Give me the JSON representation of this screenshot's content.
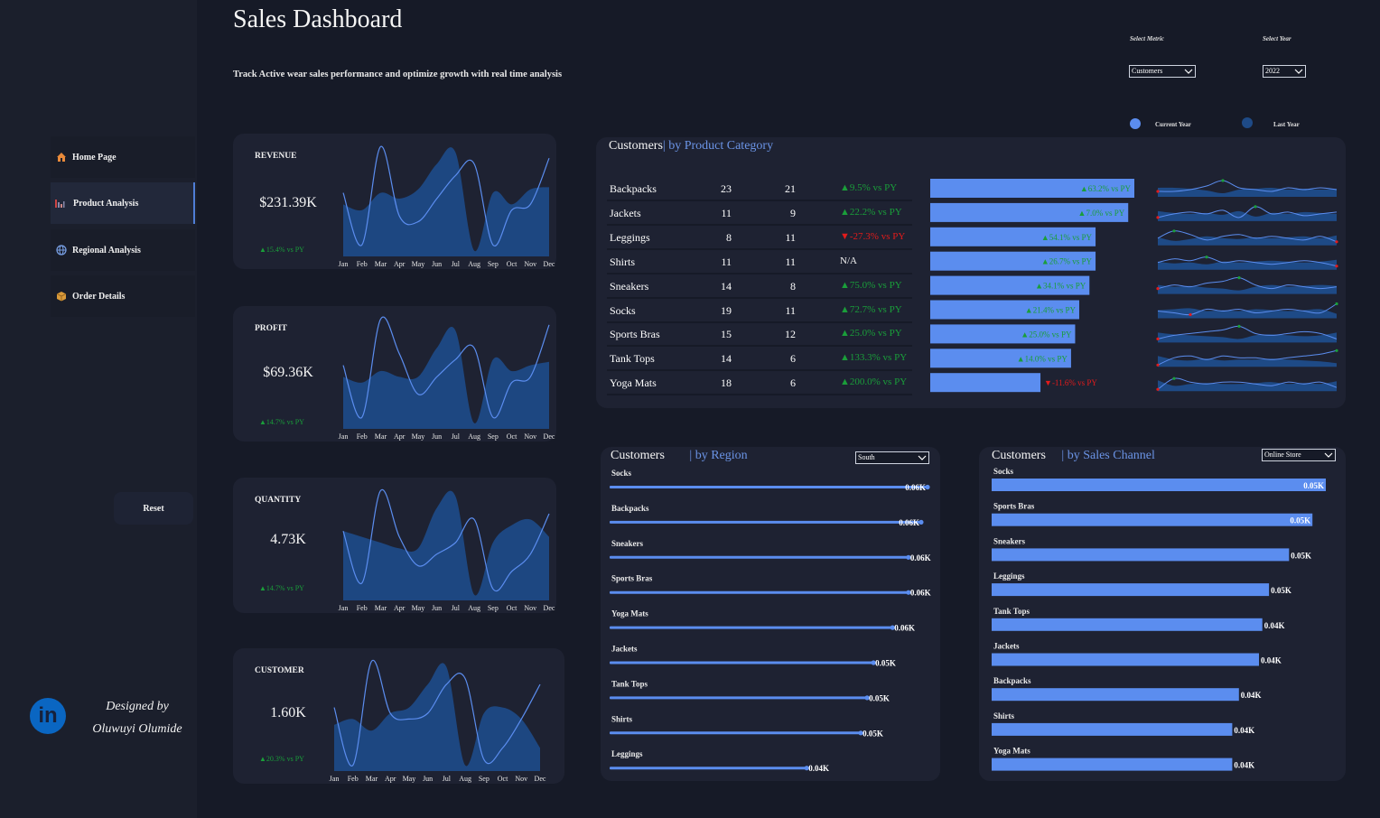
{
  "header": {
    "title": "Sales Dashboard",
    "subtitle": "Track Active wear sales performance and optimize growth with real time analysis",
    "metric_label": "Select Metric",
    "metric_value": "Customers",
    "year_label": "Select Year",
    "year_value": "2022",
    "legend_current": "Current Year",
    "legend_last": "Last Year"
  },
  "colors": {
    "accent": "#6b94e6",
    "current": "#5b8def",
    "last": "#1e4a86",
    "up": "#1a9e3a",
    "down": "#e21b1b",
    "bg": "#161a27",
    "card": "#1e2232"
  },
  "nav": {
    "home": "Home Page",
    "product": "Product Analysis",
    "regional": "Regional Analysis",
    "orders": "Order Details",
    "icons": {
      "home": "home-icon",
      "product": "bar-chart-icon",
      "regional": "globe-icon",
      "orders": "box-icon"
    }
  },
  "reset_label": "Reset",
  "designer": {
    "line1": "Designed by",
    "line2": "Oluwuyi Olumide",
    "icon": "in"
  },
  "months": [
    "Jan",
    "Feb",
    "Mar",
    "Apr",
    "May",
    "Jun",
    "Jul",
    "Aug",
    "Sep",
    "Oct",
    "Nov",
    "Dec"
  ],
  "kpis": [
    {
      "label": "REVENUE",
      "value": "$231.39K",
      "delta": "▲15.4% vs PY"
    },
    {
      "label": "PROFIT",
      "value": "$69.36K",
      "delta": "▲14.7% vs PY"
    },
    {
      "label": "QUANTITY",
      "value": "4.73K",
      "delta": "▲14.7% vs PY"
    },
    {
      "label": "CUSTOMER",
      "value": "1.60K",
      "delta": "▲20.3% vs PY"
    }
  ],
  "product_panel": {
    "title": "Customers",
    "sub": "by Product Category",
    "rows": [
      {
        "name": "Backpacks",
        "cy": "23",
        "ly": "21",
        "delta": "▲9.5% vs PY",
        "dir": "up",
        "bar_pct": 1.0,
        "bar_label": "▲63.2% vs PY",
        "bar_dir": "up"
      },
      {
        "name": "Jackets",
        "cy": "11",
        "ly": "9",
        "delta": "▲22.2% vs PY",
        "dir": "up",
        "bar_pct": 0.97,
        "bar_label": "▲7.0% vs PY",
        "bar_dir": "up"
      },
      {
        "name": "Leggings",
        "cy": "8",
        "ly": "11",
        "delta": "▼-27.3% vs PY",
        "dir": "down",
        "bar_pct": 0.81,
        "bar_label": "▲54.1% vs PY",
        "bar_dir": "up"
      },
      {
        "name": "Shirts",
        "cy": "11",
        "ly": "11",
        "delta": "N/A",
        "dir": "na",
        "bar_pct": 0.81,
        "bar_label": "▲26.7% vs PY",
        "bar_dir": "up"
      },
      {
        "name": "Sneakers",
        "cy": "14",
        "ly": "8",
        "delta": "▲75.0% vs PY",
        "dir": "up",
        "bar_pct": 0.78,
        "bar_label": "▲34.1% vs PY",
        "bar_dir": "up"
      },
      {
        "name": "Socks",
        "cy": "19",
        "ly": "11",
        "delta": "▲72.7% vs PY",
        "dir": "up",
        "bar_pct": 0.73,
        "bar_label": "▲21.4% vs PY",
        "bar_dir": "up"
      },
      {
        "name": "Sports Bras",
        "cy": "15",
        "ly": "12",
        "delta": "▲25.0% vs PY",
        "dir": "up",
        "bar_pct": 0.71,
        "bar_label": "▲25.0% vs PY",
        "bar_dir": "up"
      },
      {
        "name": "Tank Tops",
        "cy": "14",
        "ly": "6",
        "delta": "▲133.3% vs PY",
        "dir": "up",
        "bar_pct": 0.69,
        "bar_label": "▲14.0% vs PY",
        "bar_dir": "up"
      },
      {
        "name": "Yoga Mats",
        "cy": "18",
        "ly": "6",
        "delta": "▲200.0% vs PY",
        "dir": "up",
        "bar_pct": 0.54,
        "bar_label": "▼-11.6% vs PY",
        "bar_dir": "down"
      }
    ]
  },
  "region_panel": {
    "title": "Customers",
    "sub": "by Region",
    "filter": "South",
    "items": [
      {
        "name": "Socks",
        "pct": 1.0,
        "label": "0.06K"
      },
      {
        "name": "Backpacks",
        "pct": 0.98,
        "label": "0.06K"
      },
      {
        "name": "Sneakers",
        "pct": 0.94,
        "label": "0.06K"
      },
      {
        "name": "Sports Bras",
        "pct": 0.94,
        "label": "0.06K"
      },
      {
        "name": "Yoga Mats",
        "pct": 0.89,
        "label": "0.06K"
      },
      {
        "name": "Jackets",
        "pct": 0.83,
        "label": "0.05K"
      },
      {
        "name": "Tank Tops",
        "pct": 0.81,
        "label": "0.05K"
      },
      {
        "name": "Shirts",
        "pct": 0.79,
        "label": "0.05K"
      },
      {
        "name": "Leggings",
        "pct": 0.62,
        "label": "0.04K"
      }
    ]
  },
  "channel_panel": {
    "title": "Customers",
    "sub": "by Sales Channel",
    "filter": "Online Store",
    "items": [
      {
        "name": "Socks",
        "pct": 1.0,
        "label": "0.05K"
      },
      {
        "name": "Sports Bras",
        "pct": 0.96,
        "label": "0.05K"
      },
      {
        "name": "Sneakers",
        "pct": 0.89,
        "label": "0.05K"
      },
      {
        "name": "Leggings",
        "pct": 0.83,
        "label": "0.05K"
      },
      {
        "name": "Tank Tops",
        "pct": 0.81,
        "label": "0.04K"
      },
      {
        "name": "Jackets",
        "pct": 0.8,
        "label": "0.04K"
      },
      {
        "name": "Backpacks",
        "pct": 0.74,
        "label": "0.04K"
      },
      {
        "name": "Shirts",
        "pct": 0.72,
        "label": "0.04K"
      },
      {
        "name": "Yoga Mats",
        "pct": 0.72,
        "label": "0.04K"
      }
    ]
  }
}
